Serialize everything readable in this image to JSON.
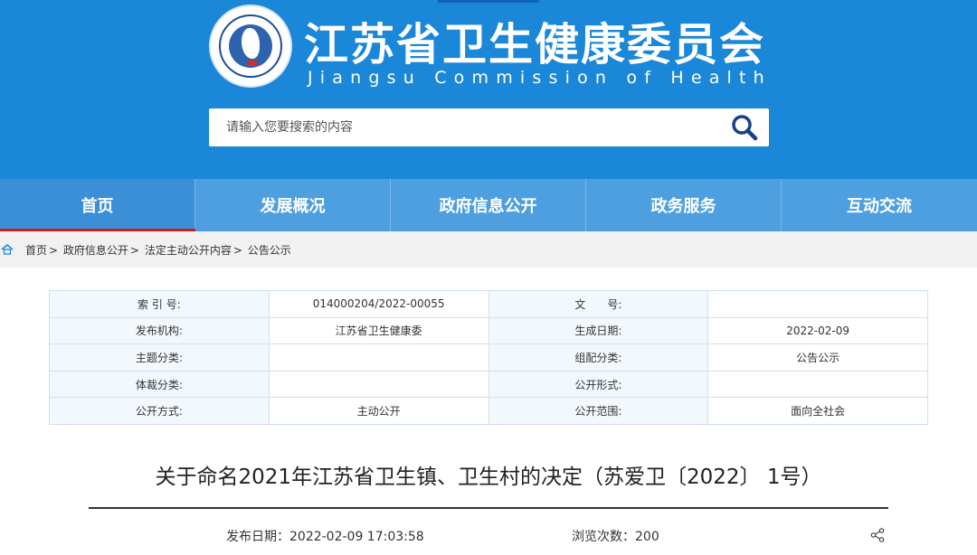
{
  "header": {
    "title": "江苏省卫生健康委员会",
    "subtitle": "Jiangsu Commission of Health",
    "emblem_text": "Jiangsu Commission of Health",
    "colors": {
      "header_bg": "#1a87d9",
      "nav_bg": "#4e9fe0",
      "active_underline": "#c5201f"
    }
  },
  "search": {
    "placeholder": "请输入您要搜索的内容",
    "value": "",
    "icon": "search-icon"
  },
  "nav": {
    "items": [
      {
        "label": "首页",
        "active": true
      },
      {
        "label": "发展概况"
      },
      {
        "label": "政府信息公开"
      },
      {
        "label": "政务服务"
      },
      {
        "label": "互动交流"
      }
    ]
  },
  "breadcrumb": {
    "icon": "home-icon",
    "items": [
      "首页",
      "政府信息公开",
      "法定主动公开内容",
      "公告公示"
    ],
    "separator": ">"
  },
  "info_table": {
    "rows": [
      [
        {
          "k": "索 引 号:",
          "v": "014000204/2022-00055"
        },
        {
          "k": "文　　号:",
          "v": ""
        }
      ],
      [
        {
          "k": "发布机构:",
          "v": "江苏省卫生健康委"
        },
        {
          "k": "生成日期:",
          "v": "2022-02-09"
        }
      ],
      [
        {
          "k": "主题分类:",
          "v": ""
        },
        {
          "k": "组配分类:",
          "v": "公告公示"
        }
      ],
      [
        {
          "k": "体裁分类:",
          "v": ""
        },
        {
          "k": "公开形式:",
          "v": ""
        }
      ],
      [
        {
          "k": "公开方式:",
          "v": "主动公开"
        },
        {
          "k": "公开范围:",
          "v": "面向全社会"
        }
      ]
    ]
  },
  "article": {
    "title": "关于命名2021年江苏省卫生镇、卫生村的决定（苏爱卫〔2022〕 1号）",
    "date_label": "发布日期：",
    "date": "2022-02-09 17:03:58",
    "views_label": "浏览次数：",
    "views": "200",
    "share_icon": "share-icon"
  }
}
